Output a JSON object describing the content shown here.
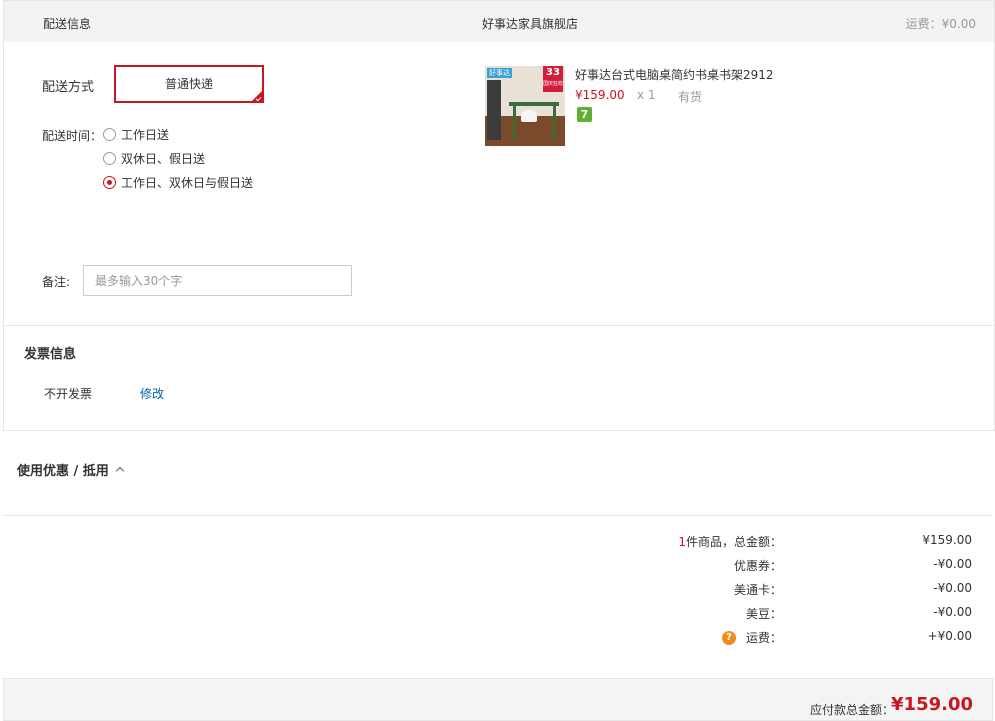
{
  "shipping": {
    "section_label": "配送信息",
    "shop_name": "好事达家具旗舰店",
    "fee_text": "运费：¥0.00",
    "method_label": "配送方式",
    "method_selected": "普通快递",
    "time_label": "配送时间：",
    "time_options": [
      {
        "label": "工作日送",
        "selected": false
      },
      {
        "label": "双休日、假日送",
        "selected": false
      },
      {
        "label": "工作日、双休日与假日送",
        "selected": true
      }
    ],
    "remark_label": "备注:",
    "remark_placeholder": "最多输入30个字",
    "remark_value": ""
  },
  "product": {
    "title": "好事达台式电脑桌简约书桌书架2912",
    "price": "¥159.00",
    "qty": "x 1",
    "stock": "有货",
    "return_badge": "7",
    "image_brand_text": "好事达",
    "image_promo_text": "33",
    "image_promo_sub": "国庆狂欢"
  },
  "invoice": {
    "title": "发票信息",
    "type": "不开发票",
    "edit_label": "修改"
  },
  "coupon": {
    "toggle_label": "使用优惠 / 抵用"
  },
  "summary": {
    "count": "1",
    "count_suffix": "件商品，总金额：",
    "total": "¥159.00",
    "coupon_label": "优惠券：",
    "coupon_value": "-¥0.00",
    "card_label": "美通卡：",
    "card_value": "-¥0.00",
    "bean_label": "美豆：",
    "bean_value": "-¥0.00",
    "freight_label": "运费：",
    "freight_value": "+¥0.00",
    "help_icon_glyph": "?"
  },
  "payable": {
    "label": "应付款总金额：",
    "value": "¥159.00"
  },
  "colors": {
    "accent": "#c81623",
    "link": "#005ea7",
    "help": "#f08c1e",
    "badge": "#5fb030"
  }
}
